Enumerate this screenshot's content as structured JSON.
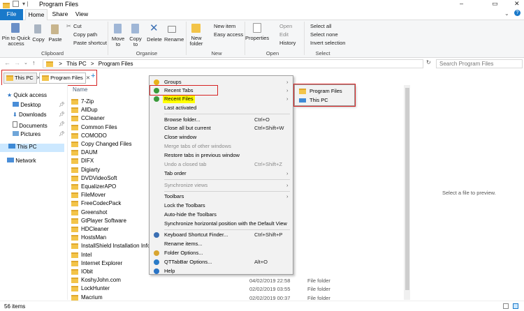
{
  "window": {
    "title": "Program Files",
    "controls": [
      "–",
      "▭",
      "✕"
    ]
  },
  "ribbon_tabs": {
    "file": "File",
    "home": "Home",
    "share": "Share",
    "view": "View"
  },
  "ribbon": {
    "pin": "Pin to Quick access",
    "copy": "Copy",
    "paste": "Paste",
    "cut": "Cut",
    "copy_path": "Copy path",
    "paste_shortcut": "Paste shortcut",
    "move_to": "Move to",
    "copy_to": "Copy to",
    "delete": "Delete",
    "rename": "Rename",
    "new_folder": "New folder",
    "new_item": "New item",
    "easy_access": "Easy access",
    "properties": "Properties",
    "open": "Open",
    "edit": "Edit",
    "history": "History",
    "select_all": "Select all",
    "select_none": "Select none",
    "invert_selection": "Invert selection",
    "groups": {
      "clipboard": "Clipboard",
      "organise": "Organise",
      "new": "New",
      "open": "Open",
      "select": "Select"
    }
  },
  "address": {
    "crumbs": [
      "This PC",
      "Program Files"
    ],
    "separator": ">",
    "search_placeholder": "Search Program Files"
  },
  "qt_tabs": [
    {
      "label": "This PC"
    },
    {
      "label": "Program Files"
    }
  ],
  "qt_add": "+",
  "nav": {
    "items": [
      "Quick access",
      "Desktop",
      "Downloads",
      "Documents",
      "Pictures",
      "This PC",
      "Network"
    ]
  },
  "list": {
    "column_name": "Name",
    "files": [
      {
        "name": "7-Zip",
        "date": "",
        "type": ""
      },
      {
        "name": "AllDup",
        "date": "",
        "type": ""
      },
      {
        "name": "CCleaner",
        "date": "",
        "type": ""
      },
      {
        "name": "Common Files",
        "date": "",
        "type": ""
      },
      {
        "name": "COMODO",
        "date": "",
        "type": ""
      },
      {
        "name": "Copy Changed Files",
        "date": "",
        "type": ""
      },
      {
        "name": "DAUM",
        "date": "",
        "type": ""
      },
      {
        "name": "DIFX",
        "date": "",
        "type": ""
      },
      {
        "name": "Digiarty",
        "date": "",
        "type": ""
      },
      {
        "name": "DVDVideoSoft",
        "date": "",
        "type": ""
      },
      {
        "name": "EqualizerAPO",
        "date": "",
        "type": ""
      },
      {
        "name": "FileMover",
        "date": "",
        "type": ""
      },
      {
        "name": "FreeCodecPack",
        "date": "",
        "type": ""
      },
      {
        "name": "Greenshot",
        "date": "",
        "type": ""
      },
      {
        "name": "GtPlayer Software",
        "date": "",
        "type": ""
      },
      {
        "name": "HDCleaner",
        "date": "",
        "type": ""
      },
      {
        "name": "HostsMan",
        "date": "",
        "type": ""
      },
      {
        "name": "InstallShield Installation Informa",
        "date": "",
        "type": ""
      },
      {
        "name": "Intel",
        "date": "",
        "type": ""
      },
      {
        "name": "Internet Explorer",
        "date": "",
        "type": ""
      },
      {
        "name": "IObit",
        "date": "",
        "type": ""
      },
      {
        "name": "KoshyJohn.com",
        "date": "04/02/2019 22:58",
        "type": "File folder"
      },
      {
        "name": "LockHunter",
        "date": "02/02/2019 03:55",
        "type": "File folder"
      },
      {
        "name": "Macrium",
        "date": "02/02/2019 00:37",
        "type": "File folder"
      }
    ]
  },
  "menu": {
    "items": [
      {
        "label": "Groups",
        "shortcut": "",
        "arrow": true,
        "disabled": false,
        "icon": "star-icon"
      },
      {
        "label": "Recent Tabs",
        "shortcut": "",
        "arrow": true,
        "disabled": false,
        "icon": "clock-icon"
      },
      {
        "label": "Recent Files",
        "shortcut": "",
        "arrow": true,
        "disabled": false,
        "icon": "clock-icon"
      },
      {
        "label": "Last activated",
        "shortcut": "",
        "arrow": false,
        "disabled": false,
        "icon": ""
      },
      {
        "label": "Browse folder...",
        "shortcut": "Ctrl+O",
        "arrow": false,
        "disabled": false,
        "icon": ""
      },
      {
        "label": "Close all but current",
        "shortcut": "Ctrl+Shift+W",
        "arrow": false,
        "disabled": false,
        "icon": ""
      },
      {
        "label": "Close window",
        "shortcut": "",
        "arrow": false,
        "disabled": false,
        "icon": ""
      },
      {
        "label": "Merge tabs of other windows",
        "shortcut": "",
        "arrow": false,
        "disabled": true,
        "icon": ""
      },
      {
        "label": "Restore tabs in previous window",
        "shortcut": "",
        "arrow": false,
        "disabled": false,
        "icon": ""
      },
      {
        "label": "Undo a closed tab",
        "shortcut": "Ctrl+Shift+Z",
        "arrow": false,
        "disabled": true,
        "icon": ""
      },
      {
        "label": "Tab order",
        "shortcut": "",
        "arrow": true,
        "disabled": false,
        "icon": ""
      },
      {
        "label": "Synchronize views",
        "shortcut": "",
        "arrow": true,
        "disabled": true,
        "icon": ""
      },
      {
        "label": "Toolbars",
        "shortcut": "",
        "arrow": true,
        "disabled": false,
        "icon": ""
      },
      {
        "label": "Lock the Toolbars",
        "shortcut": "",
        "arrow": false,
        "disabled": false,
        "icon": ""
      },
      {
        "label": "Auto-hide the Toolbars",
        "shortcut": "",
        "arrow": false,
        "disabled": false,
        "icon": ""
      },
      {
        "label": "Synchronize horizontal position with the Default View",
        "shortcut": "",
        "arrow": false,
        "disabled": false,
        "icon": ""
      },
      {
        "label": "Keyboard Shortcut Finder...",
        "shortcut": "Ctrl+Shift+P",
        "arrow": false,
        "disabled": false,
        "icon": "keyboard-icon"
      },
      {
        "label": "Rename items...",
        "shortcut": "",
        "arrow": false,
        "disabled": false,
        "icon": ""
      },
      {
        "label": "Folder Options...",
        "shortcut": "",
        "arrow": false,
        "disabled": false,
        "icon": "folder-options-icon"
      },
      {
        "label": "QTTabBar Options...",
        "shortcut": "Alt+O",
        "arrow": false,
        "disabled": false,
        "icon": "gear-icon"
      },
      {
        "label": "Help",
        "shortcut": "",
        "arrow": false,
        "disabled": false,
        "icon": "help-icon"
      }
    ]
  },
  "submenu": {
    "items": [
      "Program Files",
      "This PC"
    ]
  },
  "preview_text": "Select a file to preview.",
  "status": "56 items",
  "colors": {
    "file_tab": "#1979ca",
    "highlight": "#ffff00",
    "red_outline": "#d62323",
    "folder": "#f3c449"
  }
}
